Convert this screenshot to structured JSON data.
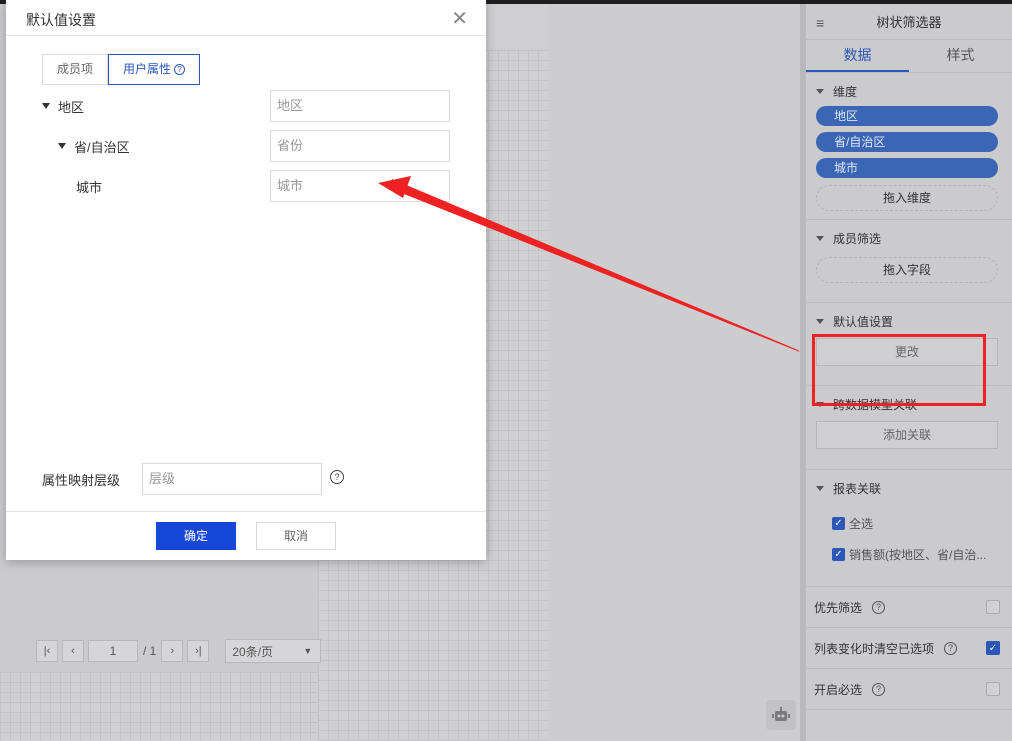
{
  "modal": {
    "title": "默认值设置",
    "close": "✕",
    "tabs": [
      {
        "label": "成员项",
        "active": false
      },
      {
        "label": "用户属性",
        "active": true
      }
    ],
    "tree": [
      {
        "label": "地区",
        "placeholder": "地区"
      },
      {
        "label": "省/自治区",
        "placeholder": "省份"
      },
      {
        "label": "城市",
        "placeholder": "城市"
      }
    ],
    "level_label": "属性映射层级",
    "level_placeholder": "层级",
    "ok": "确定",
    "cancel": "取消"
  },
  "pager": {
    "page": "1",
    "total": "/ 1",
    "page_size": "20条/页"
  },
  "right_panel": {
    "title": "树状筛选器",
    "tabs": [
      "数据",
      "样式"
    ],
    "dimension": {
      "title": "维度",
      "chips": [
        "地区",
        "省/自治区",
        "城市"
      ],
      "drop": "拖入维度"
    },
    "member_filter": {
      "title": "成员筛选",
      "drop": "拖入字段"
    },
    "default_value": {
      "title": "默认值设置",
      "button": "更改"
    },
    "cross_model": {
      "title": "跨数据模型关联",
      "button": "添加关联"
    },
    "report_link": {
      "title": "报表关联",
      "items": [
        "全选",
        "销售额(按地区、省/自治..."
      ]
    },
    "options": [
      {
        "label": "优先筛选",
        "checked": false
      },
      {
        "label": "列表变化时清空已选项",
        "checked": true
      },
      {
        "label": "开启必选",
        "checked": false
      }
    ]
  },
  "colors": {
    "primary": "#1747d6",
    "chip": "#3a66b5",
    "annotation": "#ee2222"
  }
}
